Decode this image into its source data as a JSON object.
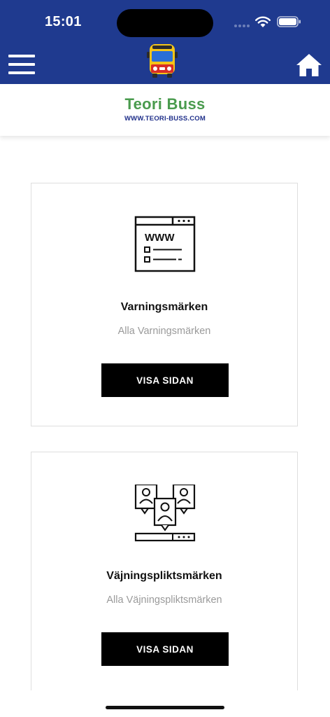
{
  "status_bar": {
    "time": "15:01"
  },
  "header": {
    "menu_icon": "hamburger-menu-icon",
    "logo_icon": "bus-icon",
    "home_icon": "home-icon",
    "background_color": "#1f3a8f"
  },
  "brand": {
    "title": "Teori Buss",
    "url": "WWW.TEORI-BUSS.COM",
    "title_color": "#4a9b4e",
    "url_color": "#1f2f8a"
  },
  "cards": [
    {
      "icon": "web-browser-icon",
      "icon_text": "WWW",
      "title": "Varningsmärken",
      "subtitle": "Alla Varningsmärken",
      "button_label": "VISA SIDAN"
    },
    {
      "icon": "users-profile-icon",
      "title": "Väjningspliktsmärken",
      "subtitle": "Alla Väjningspliktsmärken",
      "button_label": "VISA SIDAN"
    }
  ]
}
